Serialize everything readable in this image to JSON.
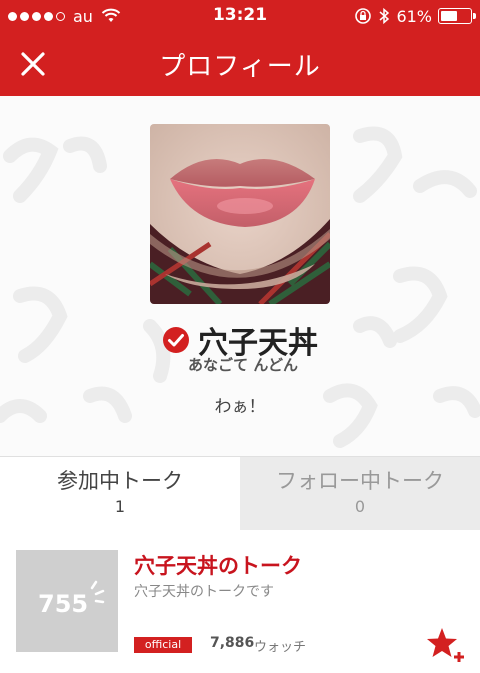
{
  "status_bar": {
    "carrier": "au",
    "signal_dots_filled": 4,
    "signal_dots_total": 5,
    "time": "13:21",
    "battery_percent": "61%",
    "battery_level": 0.61,
    "icons": [
      "wifi-icon",
      "rotation-lock-icon",
      "bluetooth-icon",
      "battery-icon"
    ]
  },
  "nav": {
    "title": "プロフィール",
    "close_icon": "close-icon"
  },
  "profile": {
    "name": "穴子天丼",
    "reading": "あなごて んどん",
    "bio": "わぁ！",
    "verified_icon": "check-circle-icon"
  },
  "tabs": [
    {
      "label": "参加中トーク",
      "count": "1",
      "active": true
    },
    {
      "label": "フォロー中トーク",
      "count": "0",
      "active": false
    }
  ],
  "talk": {
    "thumbnail_text": "755",
    "title": "穴子天丼のトーク",
    "description": "穴子天丼のトークです",
    "badge": "official",
    "watch_count": "7,886",
    "watch_label": "ウォッチ",
    "action_icon": "star-plus-icon"
  },
  "colors": {
    "brand_red": "#d32020",
    "title_red": "#c8141e",
    "tab_inactive_bg": "#ebebeb"
  }
}
